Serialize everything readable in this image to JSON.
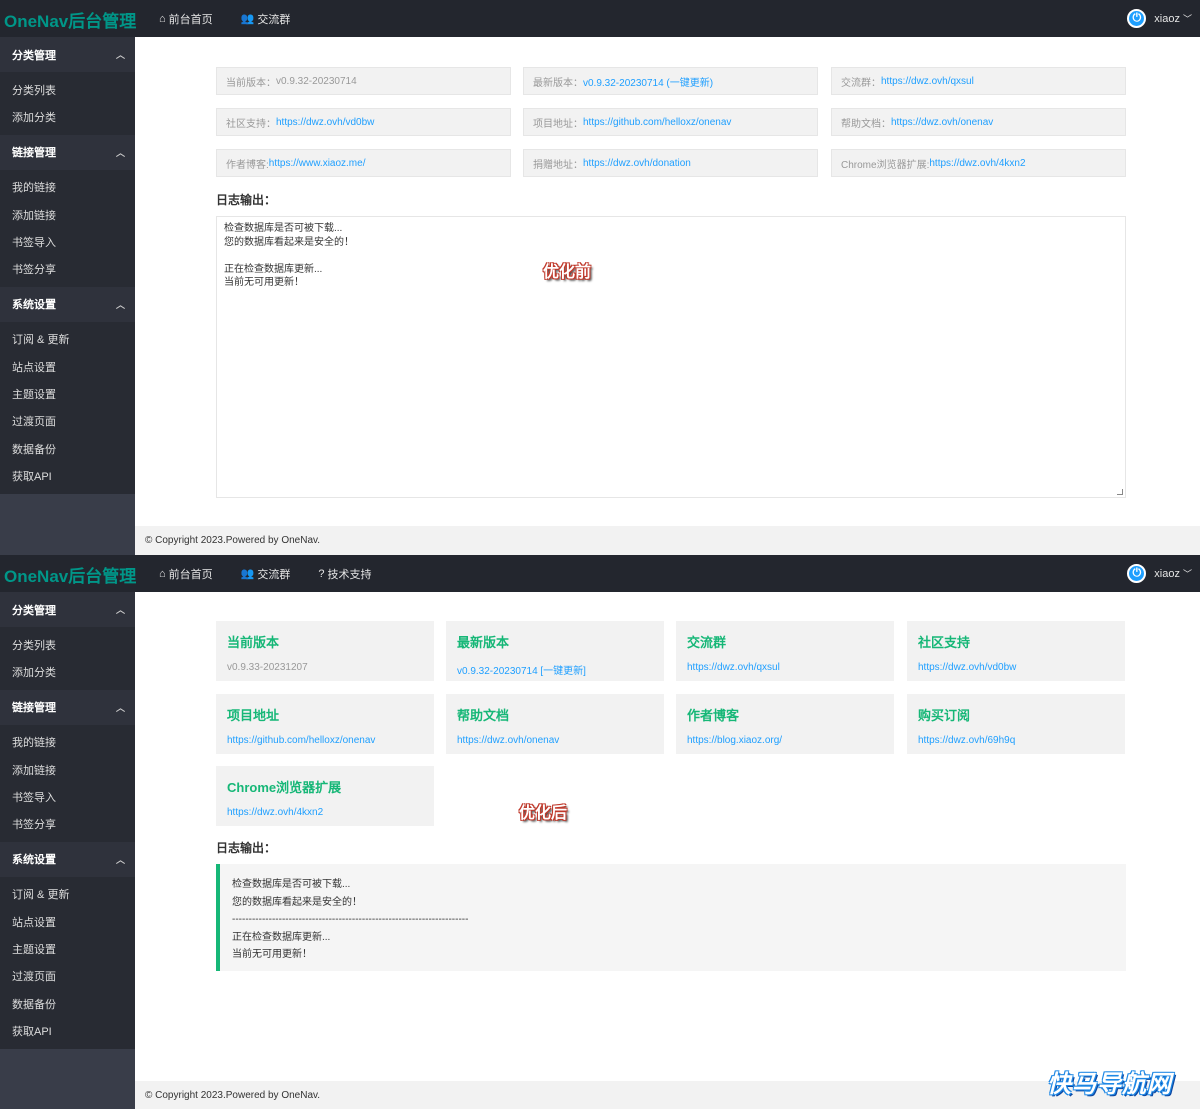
{
  "before": {
    "logo": "OneNav后台管理",
    "topnav": [
      {
        "icon": "⌂",
        "label": "前台首页"
      },
      {
        "icon": "👥",
        "label": "交流群"
      }
    ],
    "user": {
      "name": "xiaoz",
      "caret": "﹀"
    },
    "sidebar": [
      {
        "title": "分类管理",
        "items": [
          "分类列表",
          "添加分类"
        ]
      },
      {
        "title": "链接管理",
        "items": [
          "我的链接",
          "添加链接",
          "书签导入",
          "书签分享"
        ]
      },
      {
        "title": "系统设置",
        "items": [
          "订阅 & 更新",
          "站点设置",
          "主题设置",
          "过渡页面",
          "数据备份",
          "获取API"
        ]
      }
    ],
    "info": [
      {
        "label": "当前版本：",
        "value": "v0.9.32-20230714",
        "link": false
      },
      {
        "label": "最新版本：",
        "value": "v0.9.32-20230714 (一键更新)",
        "link": true
      },
      {
        "label": "交流群：",
        "value": "https://dwz.ovh/qxsul",
        "link": true
      },
      {
        "label": "社区支持：",
        "value": "https://dwz.ovh/vd0bw",
        "link": true
      },
      {
        "label": "项目地址：",
        "value": "https://github.com/helloxz/onenav",
        "link": true
      },
      {
        "label": "帮助文档：",
        "value": "https://dwz.ovh/onenav",
        "link": true
      },
      {
        "label": "作者博客: ",
        "value": "https://www.xiaoz.me/",
        "link": true
      },
      {
        "label": "捐赠地址：",
        "value": "https://dwz.ovh/donation",
        "link": true
      },
      {
        "label": "Chrome浏览器扩展: ",
        "value": "https://dwz.ovh/4kxn2",
        "link": true
      }
    ],
    "log_title": "日志输出：",
    "log_lines": [
      "检查数据库是否可被下载...",
      "您的数据库看起来是安全的！",
      "",
      "正在检查数据库更新...",
      "当前无可用更新！"
    ],
    "tag": "优化前",
    "footer": "© Copyright 2023.Powered by OneNav."
  },
  "after": {
    "logo": "OneNav后台管理",
    "topnav": [
      {
        "icon": "⌂",
        "label": "前台首页"
      },
      {
        "icon": "👥",
        "label": "交流群"
      },
      {
        "icon": "?",
        "label": "技术支持"
      }
    ],
    "user": {
      "name": "xiaoz",
      "caret": "﹀"
    },
    "sidebar": [
      {
        "title": "分类管理",
        "items": [
          "分类列表",
          "添加分类"
        ]
      },
      {
        "title": "链接管理",
        "items": [
          "我的链接",
          "添加链接",
          "书签导入",
          "书签分享"
        ]
      },
      {
        "title": "系统设置",
        "items": [
          "订阅 & 更新",
          "站点设置",
          "主题设置",
          "过渡页面",
          "数据备份",
          "获取API"
        ]
      }
    ],
    "cards": [
      {
        "title": "当前版本",
        "value": "v0.9.33-20231207",
        "link": false
      },
      {
        "title": "最新版本",
        "value": "v0.9.32-20230714 [一键更新]",
        "link": true
      },
      {
        "title": "交流群",
        "value": "https://dwz.ovh/qxsul",
        "link": true
      },
      {
        "title": "社区支持",
        "value": "https://dwz.ovh/vd0bw",
        "link": true
      },
      {
        "title": "项目地址",
        "value": "https://github.com/helloxz/onenav",
        "link": true
      },
      {
        "title": "帮助文档",
        "value": "https://dwz.ovh/onenav",
        "link": true
      },
      {
        "title": "作者博客",
        "value": "https://blog.xiaoz.org/",
        "link": true
      },
      {
        "title": "购买订阅",
        "value": "https://dwz.ovh/69h9q",
        "link": true
      },
      {
        "title": "Chrome浏览器扩展",
        "value": "https://dwz.ovh/4kxn2",
        "link": true
      }
    ],
    "log_title": "日志输出：",
    "log_lines": [
      "检查数据库是否可被下载...",
      "您的数据库看起来是安全的！",
      "-----------------------------------------------------------------------",
      "正在检查数据库更新...",
      "当前无可用更新！"
    ],
    "tag": "优化后",
    "footer": "© Copyright 2023.Powered by OneNav."
  },
  "watermark": "快马导航网",
  "colors": {
    "topbar": "#23262e",
    "sidebar": "#393d49",
    "accent_green": "#16b777",
    "link_blue": "#1e9fff",
    "logo_teal": "#009688"
  }
}
